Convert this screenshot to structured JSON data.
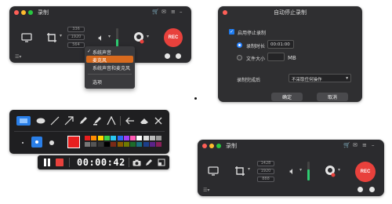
{
  "window1": {
    "title": "录制",
    "dims": [
      "336",
      "1920",
      "564"
    ],
    "rec_label": "REC",
    "colors": {
      "bg": "#2b2b2e",
      "rec": "#e8413c"
    }
  },
  "audio_menu": {
    "items": [
      "系统声音",
      "麦克风",
      "系统声音和麦克风",
      "选项"
    ],
    "checked_index": 0,
    "highlight_index": 1,
    "highlight_color": "#d86a1e"
  },
  "dialog": {
    "title": "自动停止录制",
    "enable_label": "启用停止录制",
    "duration_label": "录制时长",
    "duration_value": "00:01:00",
    "filesize_label": "文件大小",
    "filesize_unit": "MB",
    "after_label": "录制完成后",
    "after_value": "不采取任何操作",
    "ok_label": "确定",
    "cancel_label": "取消"
  },
  "draw_toolbar": {
    "tools": [
      "rectangle-icon",
      "ellipse-icon",
      "line-icon",
      "arrow-icon",
      "pencil-icon",
      "highlighter-icon",
      "text-icon",
      "undo-icon",
      "eraser-icon",
      "close-icon"
    ],
    "current_color": "#e81f1f",
    "palette": [
      "#e81f1f",
      "#ff8c00",
      "#ffd400",
      "#3ed24b",
      "#29c7f2",
      "#2a6cf2",
      "#a03ef2",
      "#ff5ab4",
      "#ffffff",
      "#dddddd",
      "#bbbbbb",
      "#999999",
      "#777777",
      "#555555",
      "#333333",
      "#000000",
      "#7b2a17",
      "#8a5a00",
      "#6f7a00",
      "#1d6b2a",
      "#1a6f80",
      "#1c3f8a",
      "#5a238a",
      "#8a1f5a"
    ]
  },
  "timer_bar": {
    "time": "00:00:42"
  },
  "window2": {
    "title": "录制",
    "dims": [
      "1428",
      "1920",
      "888"
    ],
    "rec_label": "REC"
  }
}
